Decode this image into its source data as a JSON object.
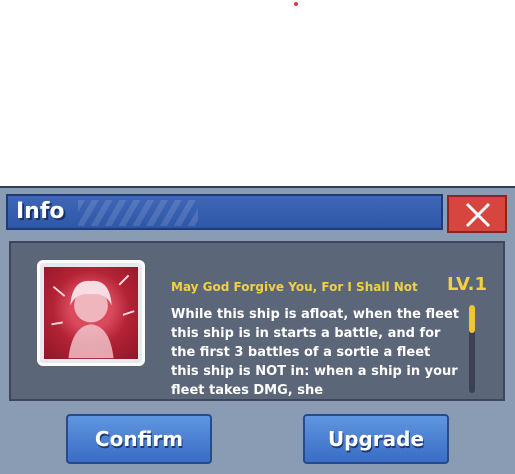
{
  "dialog": {
    "title": "Info",
    "close_icon": "close-x-icon"
  },
  "skill": {
    "name": "May God Forgive You, For I Shall Not",
    "level": "LV.1",
    "description": "While this ship is afloat, when the fleet this ship is in starts a battle, and for the first 3 battles of a sortie a fleet this ship is NOT in: when a ship in your fleet takes DMG, she"
  },
  "buttons": {
    "confirm": "Confirm",
    "upgrade": "Upgrade"
  },
  "colors": {
    "titlebar": "#2f57a8",
    "close": "#d6463f",
    "accent_text": "#f2d140",
    "button": "#4a7fd2"
  }
}
